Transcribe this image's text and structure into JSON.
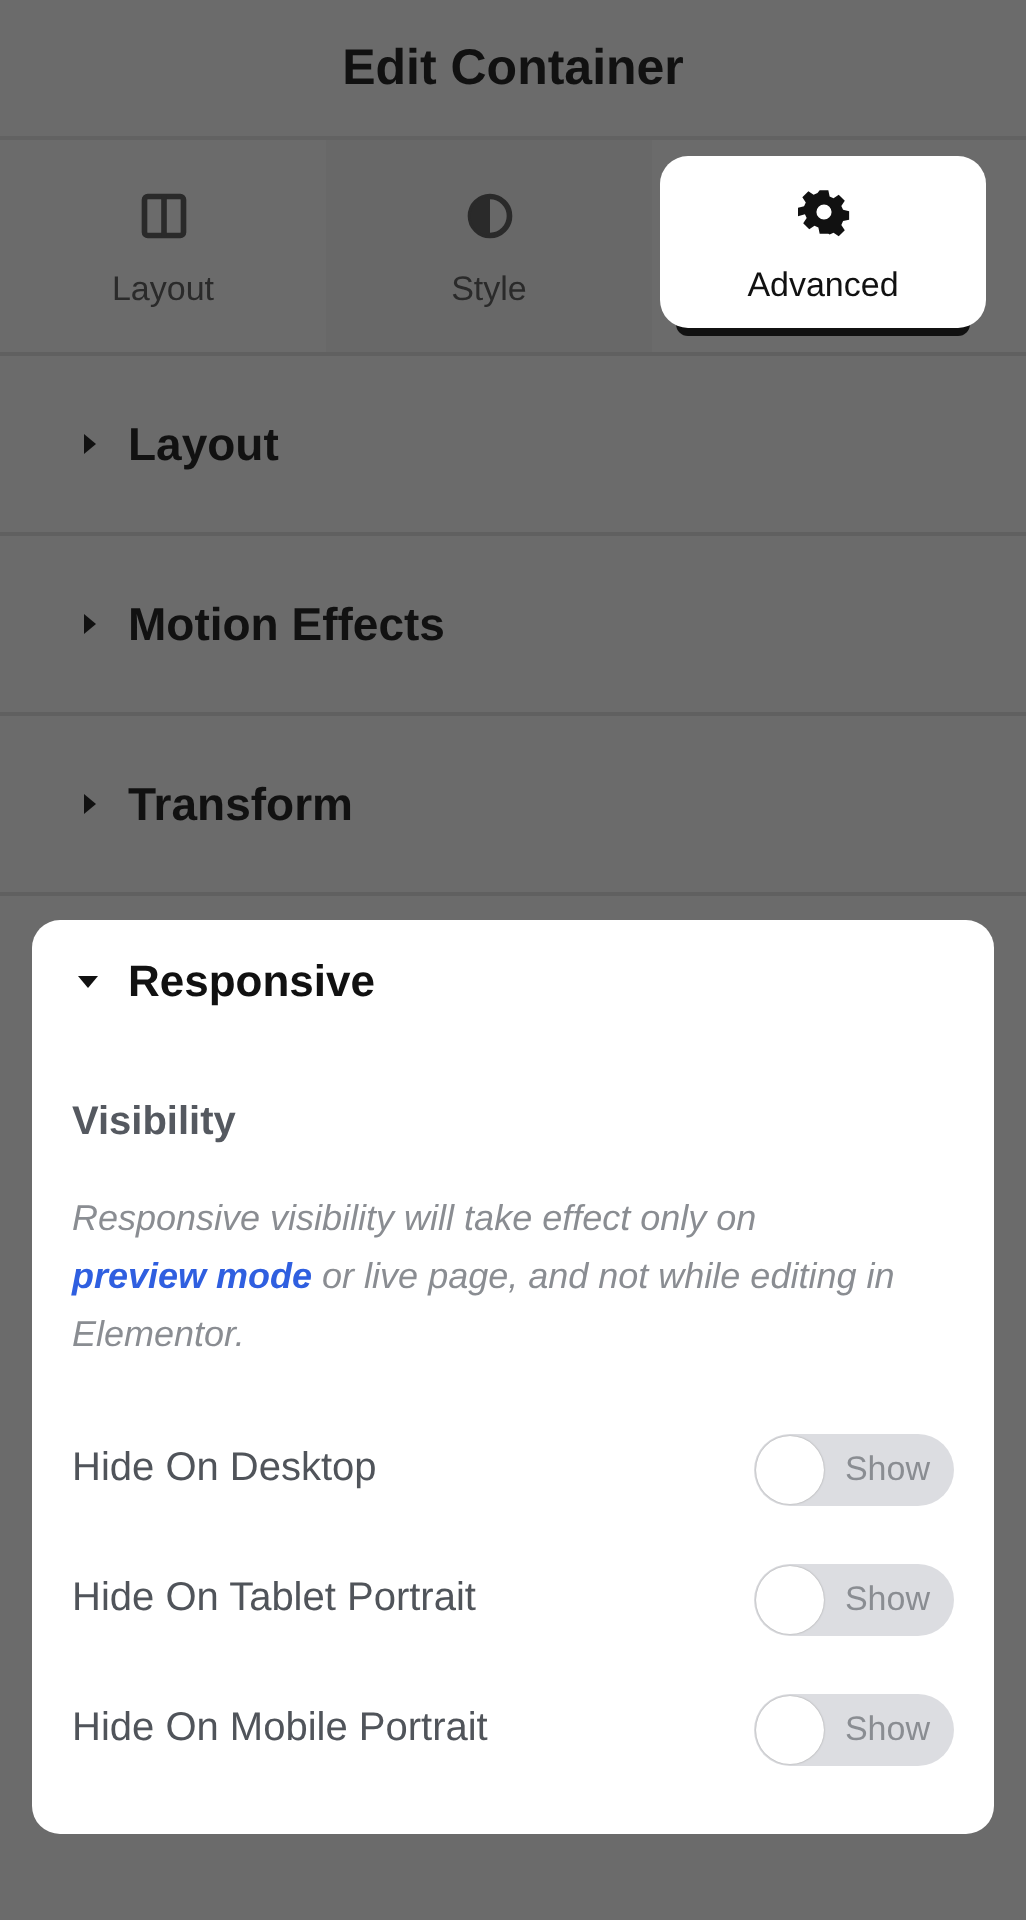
{
  "header": {
    "title": "Edit Container"
  },
  "tabs": [
    {
      "label": "Layout",
      "kind": "columns",
      "selected": false
    },
    {
      "label": "Style",
      "kind": "contrast",
      "selected": false
    },
    {
      "label": "Advanced",
      "kind": "gear",
      "selected": true
    }
  ],
  "sections": [
    {
      "title": "Layout",
      "expanded": false
    },
    {
      "title": "Motion Effects",
      "expanded": false
    },
    {
      "title": "Transform",
      "expanded": false
    },
    {
      "title": "Responsive",
      "expanded": true
    }
  ],
  "responsive": {
    "heading": "Visibility",
    "note": {
      "before": "Responsive visibility will take effect only on",
      "link": "preview mode",
      "after": "or live page, and not while editing in Elementor."
    },
    "toggles": [
      {
        "label": "Hide On Desktop",
        "state_text": "Show",
        "on": false
      },
      {
        "label": "Hide On Tablet Portrait",
        "state_text": "Show",
        "on": false
      },
      {
        "label": "Hide On Mobile Portrait",
        "state_text": "Show",
        "on": false
      }
    ]
  }
}
